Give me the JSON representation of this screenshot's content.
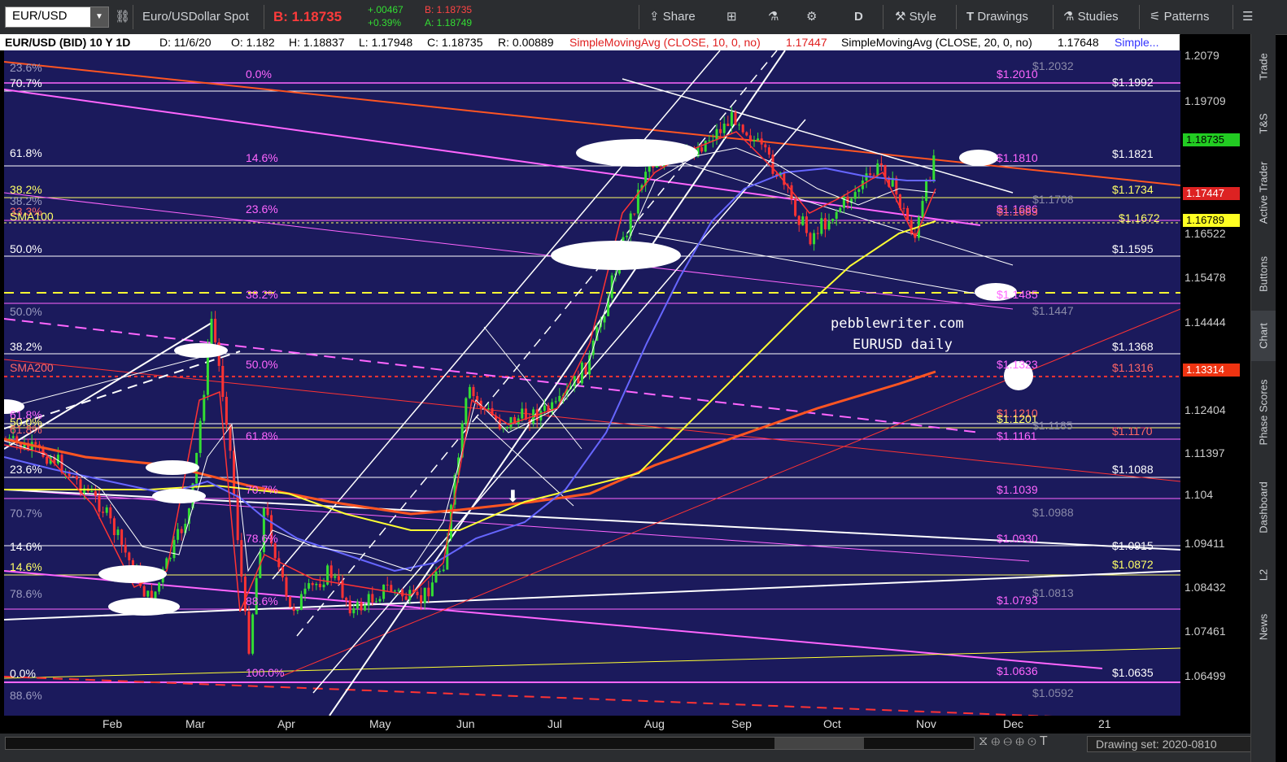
{
  "toolbar": {
    "symbol": "EUR/USD",
    "description": "Euro/USDollar Spot",
    "bid_label": "B: 1.18735",
    "change": "+.00467",
    "change_pct": "+0.39%",
    "bid_small": "B: 1.18735",
    "ask_small": "A: 1.18749",
    "share": "Share",
    "period": "D",
    "style": "Style",
    "drawings": "Drawings",
    "studies": "Studies",
    "patterns": "Patterns"
  },
  "infobar": {
    "title": "EUR/USD (BID) 10 Y 1D",
    "date": "D: 11/6/20",
    "open": "O: 1.182",
    "high": "H: 1.18837",
    "low": "L: 1.17948",
    "close": "C: 1.18735",
    "range": "R: 0.00889",
    "sma10": "SimpleMovingAvg (CLOSE, 10, 0, no)",
    "sma10_val": "1.17447",
    "sma20": "SimpleMovingAvg (CLOSE, 20, 0, no)",
    "sma20_val": "1.17648",
    "sma_more": "Simple..."
  },
  "price_axis": {
    "ticks": [
      "1.2079",
      "1.19709",
      "1.16522",
      "1.15478",
      "1.14444",
      "1.12404",
      "1.11397",
      "1.104",
      "1.09411",
      "1.08432",
      "1.07461",
      "1.06499"
    ],
    "last_price": "1.18735",
    "sma10_tag": "1.17447",
    "sma20_tag": "1.16789",
    "sma200_tag": "1.13314"
  },
  "months": [
    "Feb",
    "Mar",
    "Apr",
    "May",
    "Jun",
    "Jul",
    "Aug",
    "Sep",
    "Oct",
    "Nov",
    "Dec",
    "21"
  ],
  "left_fib_labels": [
    {
      "t": "23.6%",
      "c": "#9a9abf"
    },
    {
      "t": "70.7%",
      "c": "#ffffff"
    },
    {
      "t": "61.8%",
      "c": "#ffffff"
    },
    {
      "t": "38.2%",
      "c": "#ffff66"
    },
    {
      "t": "38.2%",
      "c": "#9a9abf"
    },
    {
      "t": "33.3%",
      "c": "#ff6666"
    },
    {
      "t": "SMA100",
      "c": "#ffff66"
    },
    {
      "t": "50.0%",
      "c": "#ffffff"
    },
    {
      "t": "50.0%",
      "c": "#9a9abf"
    },
    {
      "t": "38.2%",
      "c": "#ffffff"
    },
    {
      "t": "SMA200",
      "c": "#ff6666"
    },
    {
      "t": "61.8%",
      "c": "#ff66ff"
    },
    {
      "t": "50.0%",
      "c": "#ffff66"
    },
    {
      "t": "61.8%",
      "c": "#ff6666"
    },
    {
      "t": "23.6%",
      "c": "#ffffff"
    },
    {
      "t": "70.7%",
      "c": "#9a9abf"
    },
    {
      "t": "14.6%",
      "c": "#ffffff"
    },
    {
      "t": "14.6%",
      "c": "#ffff66"
    },
    {
      "t": "78.6%",
      "c": "#9a9abf"
    },
    {
      "t": "0.0%",
      "c": "#ffffff"
    },
    {
      "t": "88.6%",
      "c": "#9a9abf"
    }
  ],
  "mid_fib_labels": [
    "0.0%",
    "14.6%",
    "23.6%",
    "38.2%",
    "50.0%",
    "61.8%",
    "70.7%",
    "78.6%",
    "88.6%",
    "100.0%"
  ],
  "right_levels": [
    {
      "t": "$1.2032",
      "c": "#8a8aa8"
    },
    {
      "t": "$1.2010",
      "c": "#ff66ff"
    },
    {
      "t": "$1.1992",
      "c": "#ffffff"
    },
    {
      "t": "$1.1810",
      "c": "#ff66ff"
    },
    {
      "t": "$1.1821",
      "c": "#ffffff"
    },
    {
      "t": "$1.1734",
      "c": "#ffff66"
    },
    {
      "t": "$1.1708",
      "c": "#8a8aa8"
    },
    {
      "t": "$1.1686",
      "c": "#ff66ff"
    },
    {
      "t": "$1.1683",
      "c": "#ff6666"
    },
    {
      "t": "$1.1672",
      "c": "#ffff66"
    },
    {
      "t": "$1.1595",
      "c": "#ffffff"
    },
    {
      "t": "$1.1485",
      "c": "#ff66ff"
    },
    {
      "t": "$1.1447",
      "c": "#8a8aa8"
    },
    {
      "t": "$1.1368",
      "c": "#ffffff"
    },
    {
      "t": "$1.1323",
      "c": "#ff66ff"
    },
    {
      "t": "$1.1316",
      "c": "#ff6666"
    },
    {
      "t": "$1.1210",
      "c": "#ff6666"
    },
    {
      "t": "$1.1201",
      "c": "#ffff66"
    },
    {
      "t": "$1.1185",
      "c": "#8a8aa8"
    },
    {
      "t": "$1.1161",
      "c": "#ff66ff"
    },
    {
      "t": "$1.1170",
      "c": "#ff6666"
    },
    {
      "t": "$1.1088",
      "c": "#ffffff"
    },
    {
      "t": "$1.1039",
      "c": "#ff66ff"
    },
    {
      "t": "$1.0988",
      "c": "#8a8aa8"
    },
    {
      "t": "$1.0930",
      "c": "#ff66ff"
    },
    {
      "t": "$1.0915",
      "c": "#ffffff"
    },
    {
      "t": "$1.0872",
      "c": "#ffff66"
    },
    {
      "t": "$1.0813",
      "c": "#8a8aa8"
    },
    {
      "t": "$1.0793",
      "c": "#ff66ff"
    },
    {
      "t": "$1.0636",
      "c": "#ff66ff"
    },
    {
      "t": "$1.0635",
      "c": "#ffffff"
    },
    {
      "t": "$1.0592",
      "c": "#8a8aa8"
    }
  ],
  "watermark": {
    "line1": "pebblewriter.com",
    "line2": "EURUSD daily"
  },
  "sidebar_tabs": [
    "Trade",
    "T&S",
    "Active Trader",
    "Buttons",
    "Chart",
    "Phase Scores",
    "Dashboard",
    "L2",
    "News"
  ],
  "bottom": {
    "drawing_set": "Drawing set: 2020-0810"
  },
  "colors": {
    "background": "#1b1a5c",
    "up": "#33dd33",
    "down": "#ff3333",
    "sma10": "#ff3333",
    "sma20": "#ffffff",
    "sma50": "#6666ff",
    "sma100": "#ffff33",
    "sma200": "#ff5522",
    "fib": "#ff66ff"
  }
}
